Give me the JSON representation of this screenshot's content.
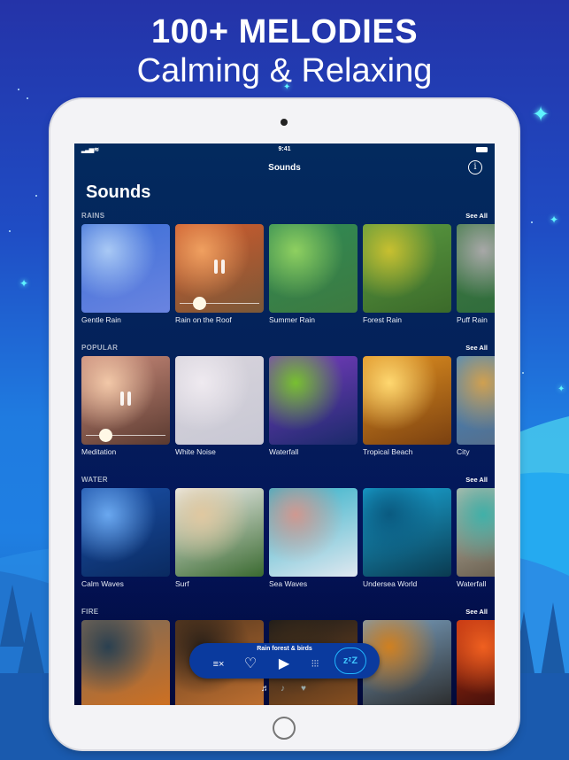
{
  "banner": {
    "headline": "100+ MELODIES",
    "subheadline": "Calming & Relaxing"
  },
  "status_bar": {
    "time": "9:41",
    "signal_icon": "cellular-signal-icon",
    "wifi_icon": "wifi-icon",
    "battery_icon": "battery-icon"
  },
  "nav": {
    "title": "Sounds",
    "info_glyph": "i"
  },
  "page_title": "Sounds",
  "sections": [
    {
      "title": "RAINS",
      "see_all": "See All",
      "items": [
        {
          "label": "Gentle Rain",
          "playing": false,
          "colors": [
            "#3c6fd8",
            "#a9c9f5",
            "#6a84e0"
          ]
        },
        {
          "label": "Rain on the Roof",
          "playing": true,
          "progress": 0.2,
          "colors": [
            "#d05a2c",
            "#f0a060",
            "#7a5838"
          ]
        },
        {
          "label": "Summer Rain",
          "playing": false,
          "colors": [
            "#2f8a55",
            "#8fd060",
            "#3d7a40"
          ]
        },
        {
          "label": "Forest Rain",
          "playing": false,
          "colors": [
            "#5a9a40",
            "#c8c030",
            "#3b6a2a"
          ]
        },
        {
          "label": "Puff Rain",
          "playing": false,
          "colors": [
            "#3f7a45",
            "#a8a8a8",
            "#2e6a3a"
          ]
        }
      ]
    },
    {
      "title": "POPULAR",
      "see_all": "See All",
      "items": [
        {
          "label": "Meditation",
          "playing": true,
          "progress": 0.2,
          "colors": [
            "#c98a7a",
            "#f2c8a8",
            "#5a3a30"
          ]
        },
        {
          "label": "White Noise",
          "playing": false,
          "colors": [
            "#d8d4dc",
            "#efeaf0",
            "#c8c8d4"
          ]
        },
        {
          "label": "Waterfall",
          "playing": false,
          "colors": [
            "#7a3cc0",
            "#78c030",
            "#1a2a6a"
          ]
        },
        {
          "label": "Tropical Beach",
          "playing": false,
          "colors": [
            "#e09020",
            "#ffd870",
            "#7a4010"
          ]
        },
        {
          "label": "City",
          "playing": false,
          "colors": [
            "#3a8ad0",
            "#d0a050",
            "#5a6a80"
          ]
        }
      ]
    },
    {
      "title": "WATER",
      "see_all": "See All",
      "items": [
        {
          "label": "Calm Waves",
          "playing": false,
          "colors": [
            "#1a50a8",
            "#6aa8f0",
            "#0a2a60"
          ]
        },
        {
          "label": "Surf",
          "playing": false,
          "colors": [
            "#f0f0f0",
            "#e0c8a0",
            "#3a6a30"
          ]
        },
        {
          "label": "Sea Waves",
          "playing": false,
          "colors": [
            "#30b0c8",
            "#d09890",
            "#e0e8f0"
          ]
        },
        {
          "label": "Undersea World",
          "playing": false,
          "colors": [
            "#1aa8d8",
            "#0a5a80",
            "#0a3a50"
          ]
        },
        {
          "label": "Waterfall",
          "playing": false,
          "colors": [
            "#c8c0b0",
            "#40b0a8",
            "#5a5040"
          ]
        }
      ]
    },
    {
      "title": "FIRE",
      "see_all": "See All",
      "items": [
        {
          "label": "",
          "playing": false,
          "colors": [
            "#7a6a5a",
            "#2a4050",
            "#d07020"
          ]
        },
        {
          "label": "",
          "playing": false,
          "colors": [
            "#5a3a20",
            "#2a2018",
            "#c07030"
          ]
        },
        {
          "label": "",
          "playing": false,
          "colors": [
            "#1a1a1a",
            "#3a2a1a",
            "#8a5020"
          ]
        },
        {
          "label": "",
          "playing": false,
          "colors": [
            "#7aa0c0",
            "#d08020",
            "#2a2a2a"
          ]
        },
        {
          "label": "",
          "playing": false,
          "colors": [
            "#c03010",
            "#f06020",
            "#2a0a0a"
          ]
        }
      ]
    }
  ],
  "player": {
    "now_playing": "Rain forest & birds",
    "clear_glyph": "≡×",
    "favorite_glyph": "♡",
    "play_glyph": "▶",
    "mixer_glyph": "⫶⫶⫶",
    "sleep_glyph": "zᶻZ",
    "accent_color": "#21b7ff"
  },
  "tabbar": {
    "tabs": [
      {
        "glyph": "♬",
        "active": true
      },
      {
        "glyph": "♪",
        "active": false
      },
      {
        "glyph": "♥",
        "active": false
      }
    ]
  }
}
